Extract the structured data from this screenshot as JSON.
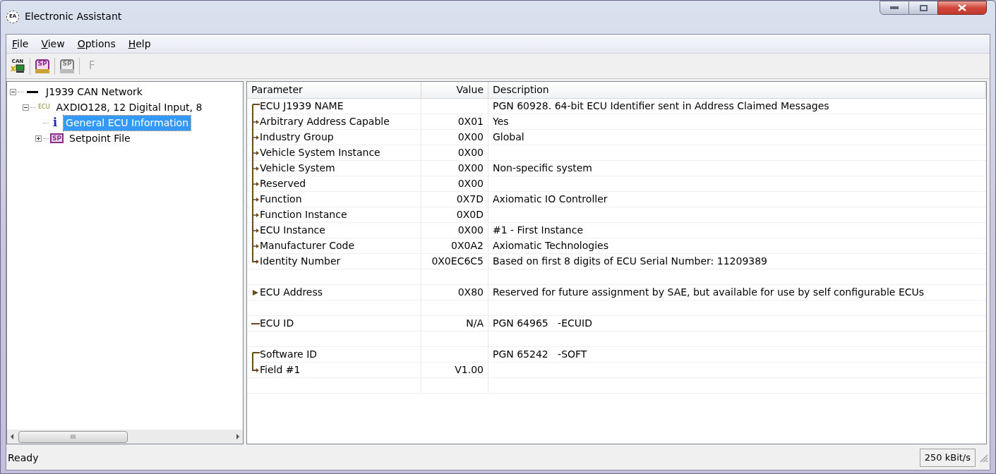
{
  "window": {
    "title": "Electronic Assistant",
    "app_badge": "EA"
  },
  "menu": [
    "File",
    "View",
    "Options",
    "Help"
  ],
  "toolbar": [
    {
      "kind": "can",
      "label": "CAN",
      "disabled": false
    },
    {
      "kind": "sp-open",
      "label": "SP",
      "disabled": false
    },
    {
      "kind": "sp-save",
      "label": "SP",
      "disabled": true
    },
    {
      "kind": "letter",
      "label": "F",
      "disabled": true
    }
  ],
  "tree": [
    {
      "kind": "network",
      "label": "J1939 CAN Network",
      "expanded": true,
      "selected": false,
      "children": [
        {
          "kind": "ecu",
          "badge": "ECU",
          "label": "AXDIO128, 12 Digital Input, 8",
          "expanded": true,
          "selected": false,
          "children": [
            {
              "kind": "info",
              "badge": "i",
              "label": "General ECU Information",
              "selected": true
            },
            {
              "kind": "setpoint",
              "badge": "SP",
              "label": "Setpoint File",
              "expanded": false,
              "selected": false
            }
          ]
        }
      ]
    }
  ],
  "table": {
    "columns": [
      "Parameter",
      "Value",
      "Description"
    ],
    "rows": [
      {
        "kind": "top",
        "parameter": "ECU J1939 NAME",
        "value": "",
        "description": "PGN 60928. 64-bit ECU Identifier sent in Address Claimed Messages"
      },
      {
        "kind": "mid",
        "parameter": "Arbitrary Address Capable",
        "value": "0X01",
        "description": "Yes"
      },
      {
        "kind": "mid",
        "parameter": "Industry Group",
        "value": "0X00",
        "description": "Global"
      },
      {
        "kind": "mid",
        "parameter": "Vehicle System Instance",
        "value": "0X00",
        "description": ""
      },
      {
        "kind": "mid",
        "parameter": "Vehicle System",
        "value": "0X00",
        "description": "Non-specific system"
      },
      {
        "kind": "mid",
        "parameter": "Reserved",
        "value": "0X00",
        "description": ""
      },
      {
        "kind": "mid",
        "parameter": "Function",
        "value": "0X7D",
        "description": "Axiomatic IO Controller"
      },
      {
        "kind": "mid",
        "parameter": "Function Instance",
        "value": "0X0D",
        "description": ""
      },
      {
        "kind": "mid",
        "parameter": "ECU Instance",
        "value": "0X00",
        "description": "#1 - First Instance"
      },
      {
        "kind": "mid",
        "parameter": "Manufacturer Code",
        "value": "0X0A2",
        "description": "Axiomatic Technologies"
      },
      {
        "kind": "last",
        "parameter": "Identity Number",
        "value": "0X0EC6C5",
        "description": "Based on first 8 digits of ECU Serial Number: 11209389"
      },
      {
        "kind": "blank"
      },
      {
        "kind": "bullet",
        "parameter": "ECU Address",
        "value": "0X80",
        "description": "Reserved for future assignment by SAE, but available for use by self configurable ECUs"
      },
      {
        "kind": "blank"
      },
      {
        "kind": "single",
        "parameter": "ECU ID",
        "value": "N/A",
        "description": "PGN 64965   -ECUID"
      },
      {
        "kind": "blank"
      },
      {
        "kind": "top",
        "parameter": "Software ID",
        "value": "",
        "description": "PGN 65242   -SOFT"
      },
      {
        "kind": "last",
        "parameter": "Field #1",
        "value": "V1.00",
        "description": ""
      },
      {
        "kind": "blank"
      }
    ]
  },
  "status_bar": {
    "message": "Ready",
    "baud": "250 kBit/s"
  }
}
